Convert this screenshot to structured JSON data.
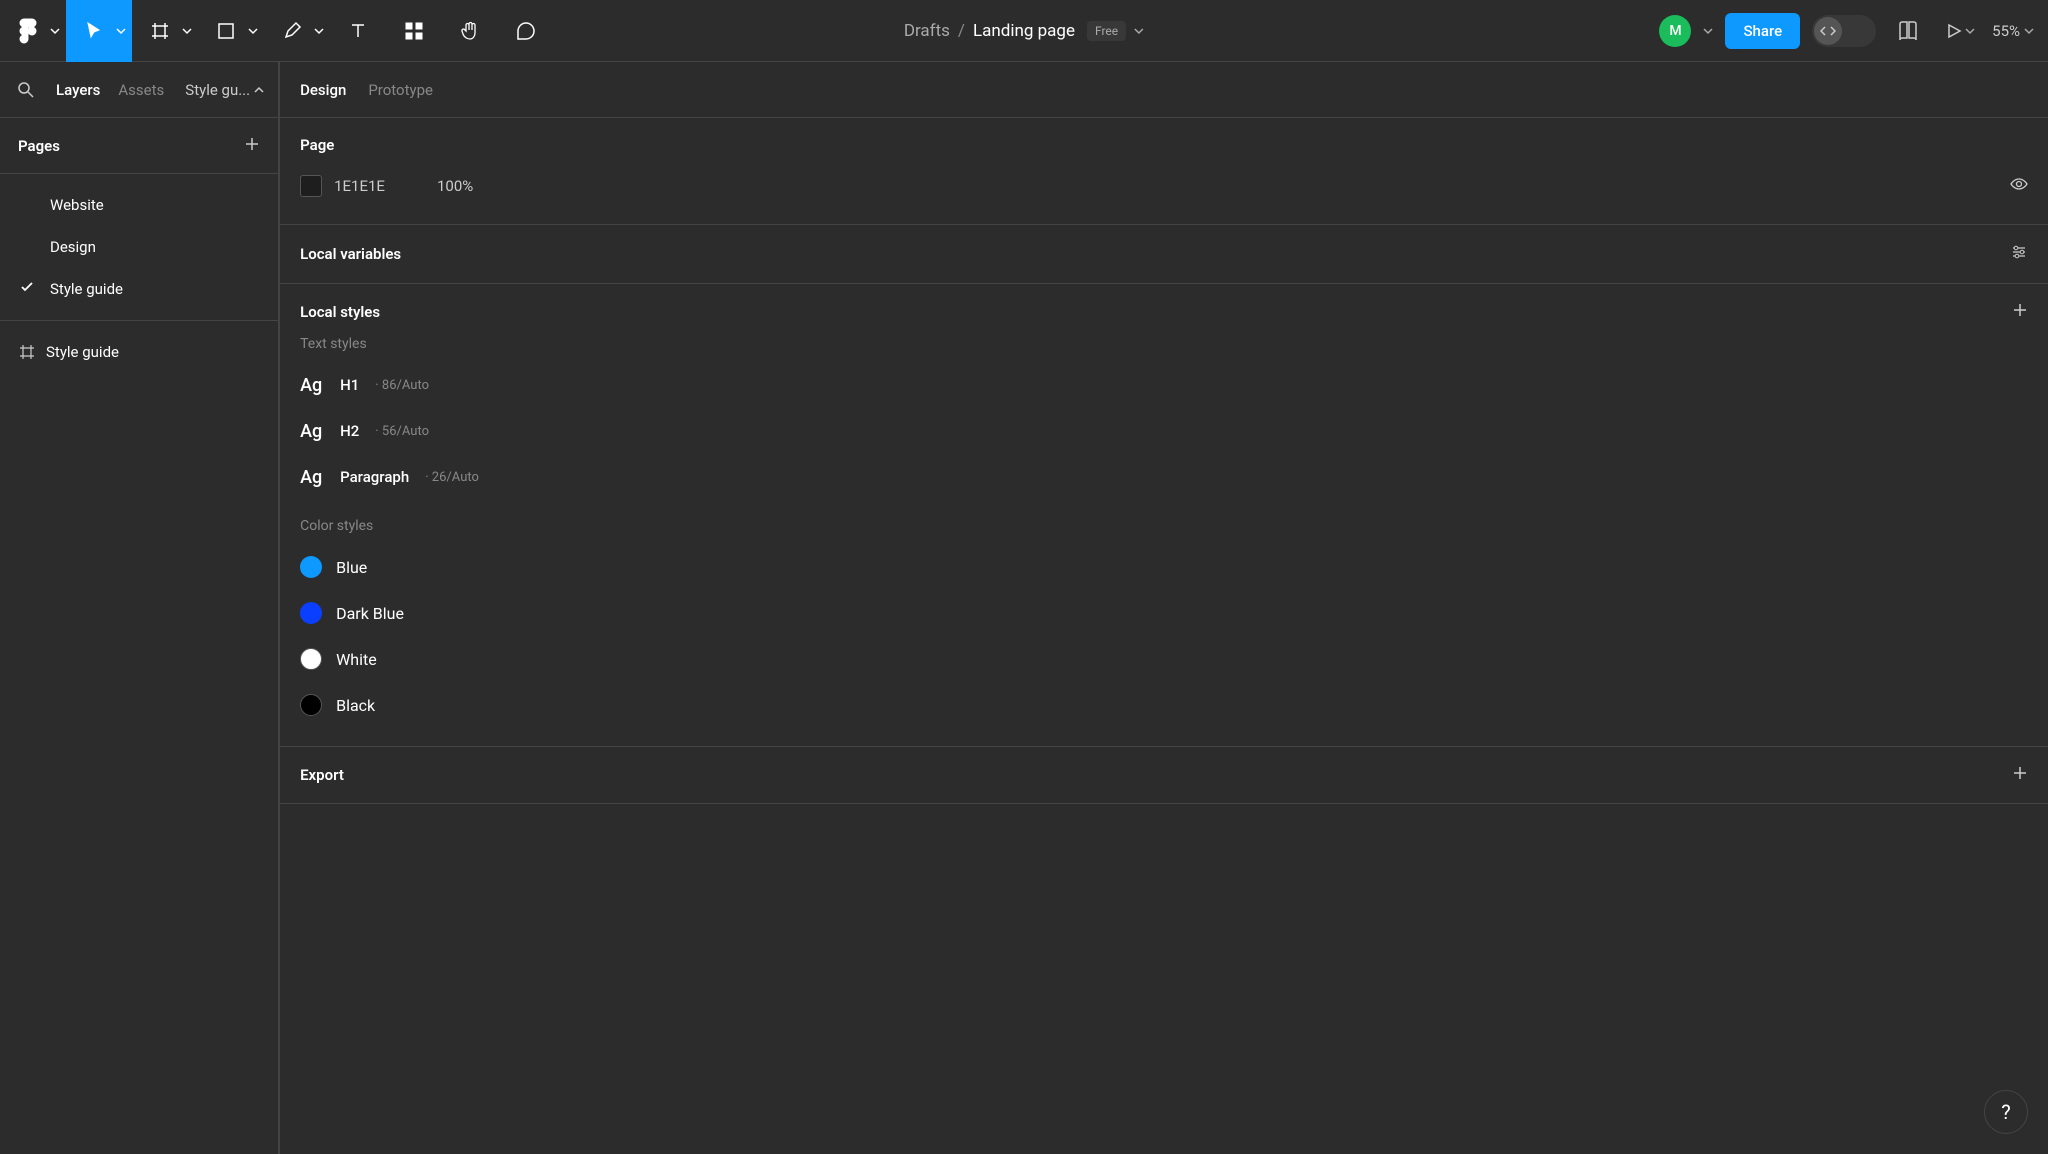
{
  "toolbar": {
    "file_location": "Drafts",
    "file_name": "Landing page",
    "plan_badge": "Free",
    "avatar_initial": "M",
    "share_label": "Share",
    "zoom": "55%"
  },
  "left_panel": {
    "tabs": {
      "layers": "Layers",
      "assets": "Assets"
    },
    "page_indicator": "Style gu...",
    "pages_header": "Pages",
    "pages": [
      {
        "name": "Website",
        "active": false
      },
      {
        "name": "Design",
        "active": false
      },
      {
        "name": "Style guide",
        "active": true
      }
    ],
    "layers": [
      {
        "name": "Style guide",
        "type": "frame"
      }
    ]
  },
  "right_panel": {
    "tabs": {
      "design": "Design",
      "prototype": "Prototype"
    },
    "page_section": {
      "title": "Page",
      "hex": "1E1E1E",
      "opacity": "100%"
    },
    "local_variables_title": "Local variables",
    "local_styles_title": "Local styles",
    "text_styles_title": "Text styles",
    "text_styles": [
      {
        "preview": "Ag",
        "name": "H1",
        "meta": "· 86/Auto"
      },
      {
        "preview": "Ag",
        "name": "H2",
        "meta": "· 56/Auto"
      },
      {
        "preview": "Ag",
        "name": "Paragraph",
        "meta": "· 26/Auto"
      }
    ],
    "color_styles_title": "Color styles",
    "color_styles": [
      {
        "name": "Blue",
        "hex": "#0d99ff"
      },
      {
        "name": "Dark Blue",
        "hex": "#0b3fff"
      },
      {
        "name": "White",
        "hex": "#ffffff"
      },
      {
        "name": "Black",
        "hex": "#000000"
      }
    ],
    "export_title": "Export"
  },
  "help_label": "?"
}
